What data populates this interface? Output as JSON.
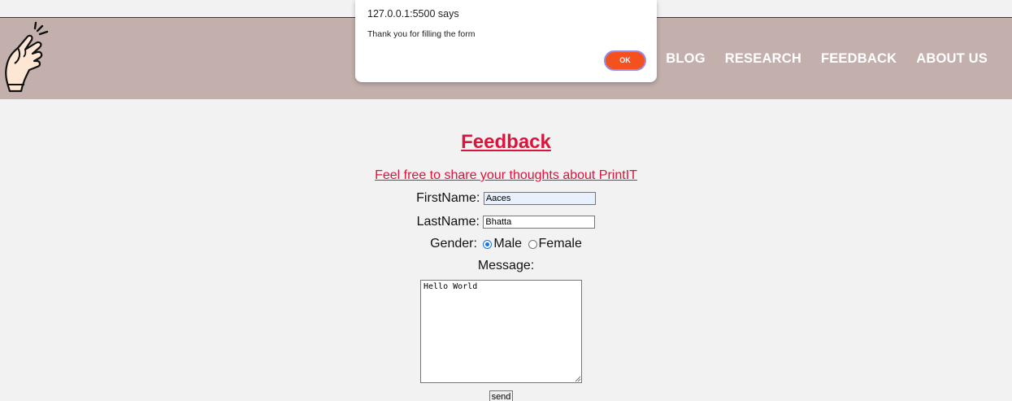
{
  "navbar": {
    "links": [
      "BLOG",
      "RESEARCH",
      "FEEDBACK",
      "ABOUT US"
    ],
    "background": "#c3b0ad",
    "logo_icon": "fingers-snap-icon"
  },
  "feedback": {
    "title": "Feedback",
    "subtitle": "Feel free to share your thoughts about PrintIT",
    "first_name_label": "FirstName:",
    "first_name_value": "Aaces",
    "last_name_label": "LastName:",
    "last_name_value": "Bhatta",
    "gender_label": "Gender:",
    "gender_options": [
      "Male",
      "Female"
    ],
    "gender_selected": "Male",
    "message_label": "Message:",
    "message_value": "Hello World",
    "send_label": "send",
    "accent_color": "#dc143c"
  },
  "dialog": {
    "origin": "127.0.0.1:5500 says",
    "message": "Thank you for filling the form",
    "ok_label": "OK",
    "ok_color": "#f4511e"
  }
}
